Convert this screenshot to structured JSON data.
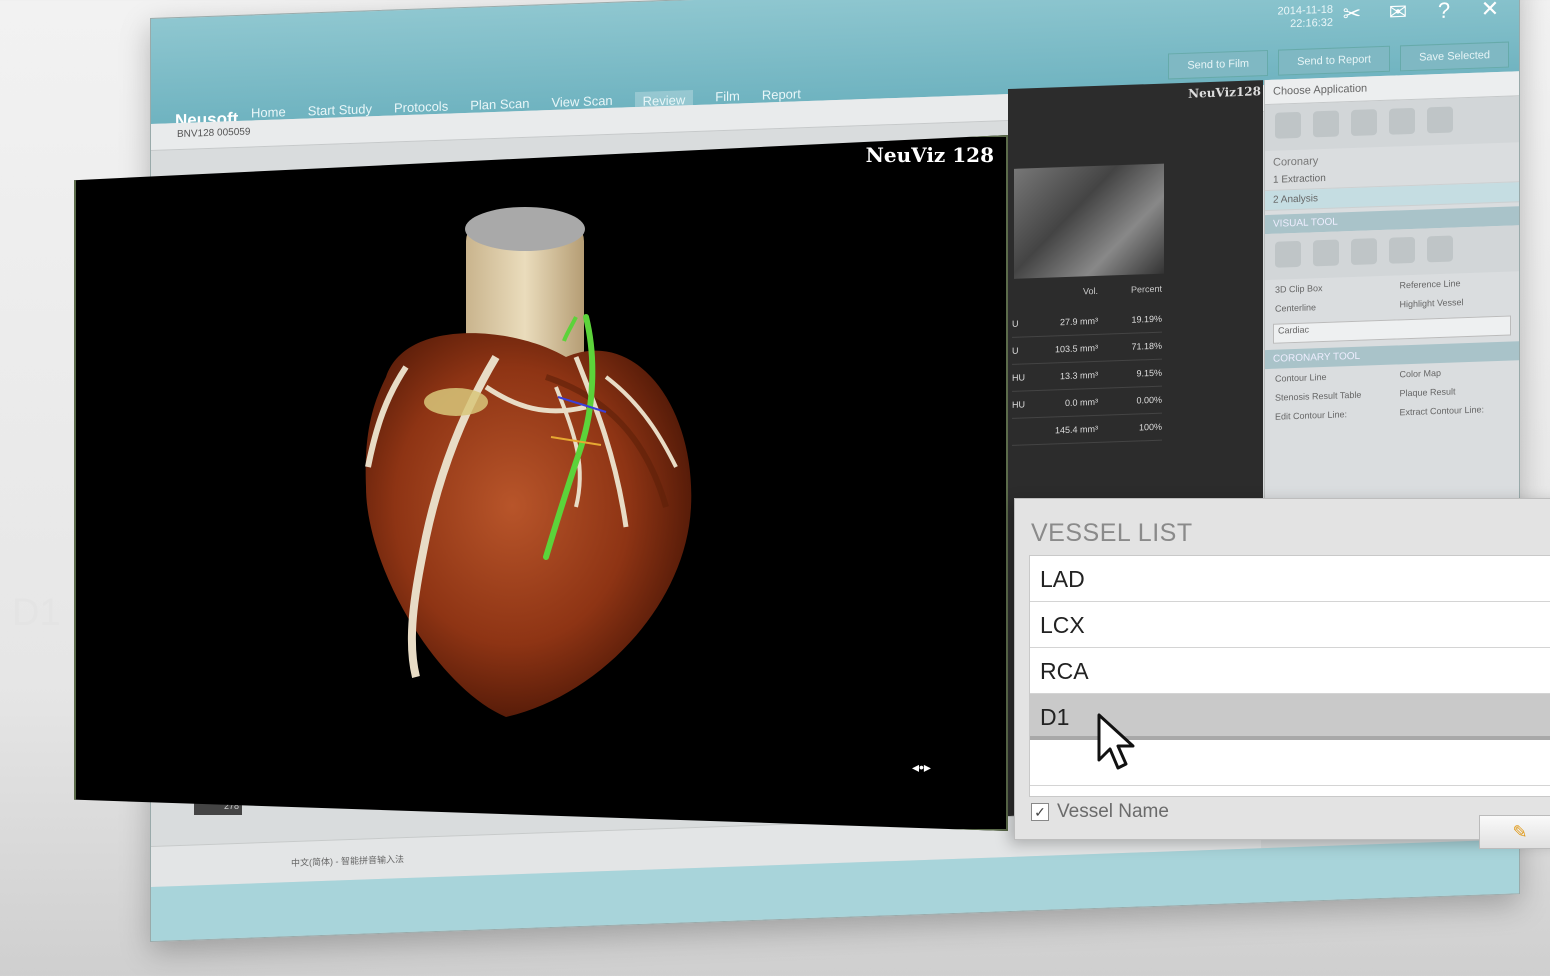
{
  "app": {
    "brand": "Neusoft",
    "nav": [
      "Home",
      "Start Study",
      "Protocols",
      "Plan Scan",
      "View Scan",
      "Review",
      "Film",
      "Report"
    ],
    "active_nav": "Review",
    "clock_date": "2014-11-18",
    "clock_time": "22:16:32",
    "actions": [
      "Send to Film",
      "Send to Report",
      "Save Selected"
    ],
    "case_id": "BNV128   005059",
    "status_lang": "中文(简体) - 智能拼音输入法",
    "thumb_label": "278"
  },
  "viewport": {
    "logo": "NeuViz 128"
  },
  "mid_panel": {
    "logo": "NeuViz128",
    "table_headers": [
      "",
      "Vol.",
      "Percent"
    ],
    "rows": [
      {
        "u": "U",
        "vol": "27.9 mm³",
        "pct": "19.19%"
      },
      {
        "u": "U",
        "vol": "103.5 mm³",
        "pct": "71.18%"
      },
      {
        "u": "HU",
        "vol": "13.3 mm³",
        "pct": "9.15%"
      },
      {
        "u": "HU",
        "vol": "0.0 mm³",
        "pct": "0.00%"
      },
      {
        "u": "",
        "vol": "145.4 mm³",
        "pct": "100%"
      }
    ]
  },
  "right_panel": {
    "choose_app": "Choose Application",
    "coronary": "Coronary",
    "steps": [
      "1   Extraction",
      "2   Analysis"
    ],
    "visual_tool": "VISUAL TOOL",
    "visual_checks": [
      "3D Clip Box",
      "Reference Line",
      "Centerline",
      "Highlight Vessel"
    ],
    "preset": "Cardiac",
    "coronary_tool": "CORONARY TOOL",
    "coronary_checks": [
      "Contour Line",
      "Color Map",
      "Stenosis Result Table",
      "Plaque Result"
    ],
    "edit_contour": "Edit Contour Line:",
    "extract_contour": "Extract Contour Line:"
  },
  "vessel_list": {
    "title": "VESSEL LIST",
    "items": [
      "LAD",
      "LCX",
      "RCA",
      "D1",
      ""
    ],
    "selected": "D1",
    "checkbox_label": "Vessel Name",
    "checkbox_checked": true
  },
  "ghost_label": "D1"
}
